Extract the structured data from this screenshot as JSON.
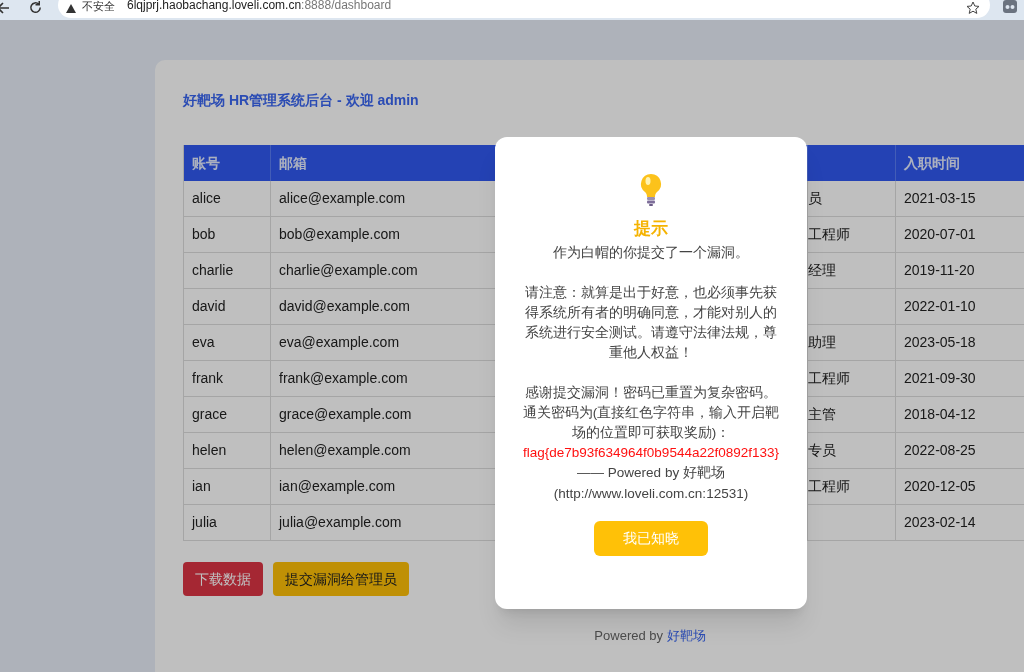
{
  "browser": {
    "security_label": "不安全",
    "url_host": "6lqjprj.haobachang.loveli.com.cn",
    "url_rest": ":8888/dashboard"
  },
  "page_title": "好靶场 HR管理系统后台 - 欢迎 admin",
  "table": {
    "headers": {
      "account": "账号",
      "email": "邮箱",
      "hire_date": "入职时间"
    },
    "rows": [
      {
        "account": "alice",
        "email": "alice@example.com",
        "column_3": "员",
        "hire_date": "2021-03-15"
      },
      {
        "account": "bob",
        "email": "bob@example.com",
        "column_3": "工程师",
        "hire_date": "2020-07-01"
      },
      {
        "account": "charlie",
        "email": "charlie@example.com",
        "column_3": "经理",
        "hire_date": "2019-11-20"
      },
      {
        "account": "david",
        "email": "david@example.com",
        "hire_date": "2022-01-10"
      },
      {
        "account": "eva",
        "email": "eva@example.com",
        "column_3": "助理",
        "hire_date": "2023-05-18"
      },
      {
        "account": "frank",
        "email": "frank@example.com",
        "column_3": "工程师",
        "hire_date": "2021-09-30"
      },
      {
        "account": "grace",
        "email": "grace@example.com",
        "column_3": "主管",
        "hire_date": "2018-04-12"
      },
      {
        "account": "helen",
        "email": "helen@example.com",
        "column_3": "专员",
        "hire_date": "2022-08-25"
      },
      {
        "account": "ian",
        "email": "ian@example.com",
        "column_3": "工程师",
        "hire_date": "2020-12-05"
      },
      {
        "account": "julia",
        "email": "julia@example.com",
        "hire_date": "2023-02-14"
      }
    ]
  },
  "buttons": [
    {
      "label": "下载数据",
      "kind": "danger"
    },
    {
      "label": "提交漏洞给管理员",
      "kind": "warning"
    }
  ],
  "footer": {
    "text": "Powered by",
    "link": "好靶场"
  },
  "modal": {
    "title": "提示",
    "paragraphs": [
      "作为白帽的你提交了一个漏洞。",
      "请注意：就算是出于好意，也必须事先获得系统所有者的明确同意，才能对别人的系统进行安全测试。请遵守法律法规，尊重他人权益！",
      "感谢提交漏洞！密码已重置为复杂密码。通关密码为(直接红色字符串，输入开启靶场的位置即可获取奖励)："
    ],
    "flag": "flag{de7b93f634964f0b9544a22f0892f133}",
    "signature": "—— Powered by 好靶场",
    "url": "(http://www.loveli.com.cn:12531)",
    "button": "我已知晓"
  }
}
